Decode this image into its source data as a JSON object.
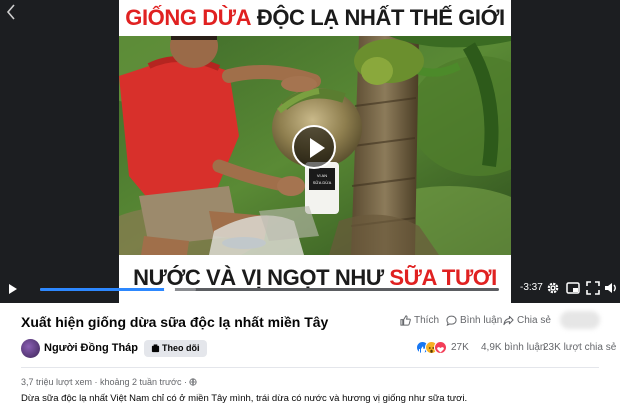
{
  "video": {
    "banner_top_red": "GIỐNG DỪA",
    "banner_top_black": "ĐỘC LẠ NHẤT THẾ GIỚI",
    "banner_bottom_black": "NƯỚC VÀ VỊ NGỌT NHƯ",
    "banner_bottom_red": "SỮA TƯƠI",
    "bottle_label": "VI AN SỮA DỪA",
    "time_remaining": "-3:37",
    "progress_fraction": 0.28,
    "buffer_fraction": 0.34,
    "icons": [
      "back-icon",
      "play-icon",
      "settings-icon",
      "picture-in-picture-icon",
      "fullscreen-icon",
      "volume-icon"
    ]
  },
  "post": {
    "title": "Xuất hiện giống dừa sữa độc lạ nhất miền Tây",
    "actions": {
      "like": "Thích",
      "comment": "Bình luận",
      "share": "Chia sẻ"
    },
    "page_name": "Người Đồng Tháp",
    "follow_label": "Theo dõi",
    "reactions_count": "27K",
    "comments_count": "4,9K bình luận",
    "shares_count": "23K lượt chia sẻ",
    "views": "3,7 triệu lượt xem",
    "time_ago": "khoảng 2 tuần trước",
    "description": "Dừa sữa độc lạ nhất Việt Nam chỉ có ở miền Tây mình, trái dừa có nước và hương vị giống như sữa tươi."
  },
  "colors": {
    "banner_red": "#e02121",
    "progress_blue": "#2d88ff",
    "like_blue": "#1877f2"
  }
}
